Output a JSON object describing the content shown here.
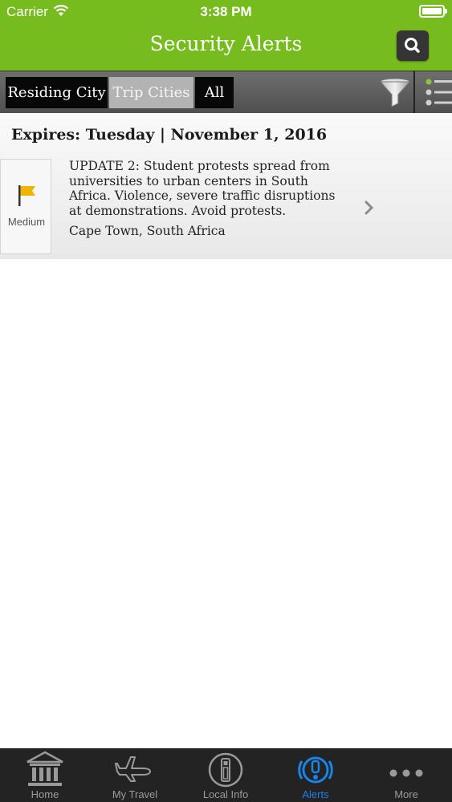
{
  "status_bar": {
    "carrier": "Carrier",
    "time": "3:38 PM"
  },
  "header": {
    "title": "Security Alerts",
    "search_icon": "search-icon"
  },
  "filters": {
    "segments": [
      "Residing City",
      "Trip Cities",
      "All"
    ],
    "selected": "Trip Cities",
    "filter_icon": "funnel-icon",
    "list_icon": "list-icon"
  },
  "alerts": {
    "expires": "Expires: Tuesday | November 1, 2016",
    "items": [
      {
        "severity": "Medium",
        "severity_color": "#f0b400",
        "text": "UPDATE 2: Student protests spread from universities to urban centers in South Africa. Violence, severe traffic disruptions at demonstrations. Avoid protests.",
        "location": "Cape Town, South Africa"
      }
    ]
  },
  "tabs": [
    {
      "label": "Home",
      "icon": "bank-icon"
    },
    {
      "label": "My Travel",
      "icon": "airplane-icon"
    },
    {
      "label": "Local Info",
      "icon": "info-icon"
    },
    {
      "label": "Alerts",
      "icon": "alert-icon",
      "active": true
    },
    {
      "label": "More",
      "icon": "more-icon"
    }
  ],
  "colors": {
    "brand_green": "#77bc1f",
    "active_tab": "#1a83e6",
    "tabbar_bg": "#232323"
  }
}
